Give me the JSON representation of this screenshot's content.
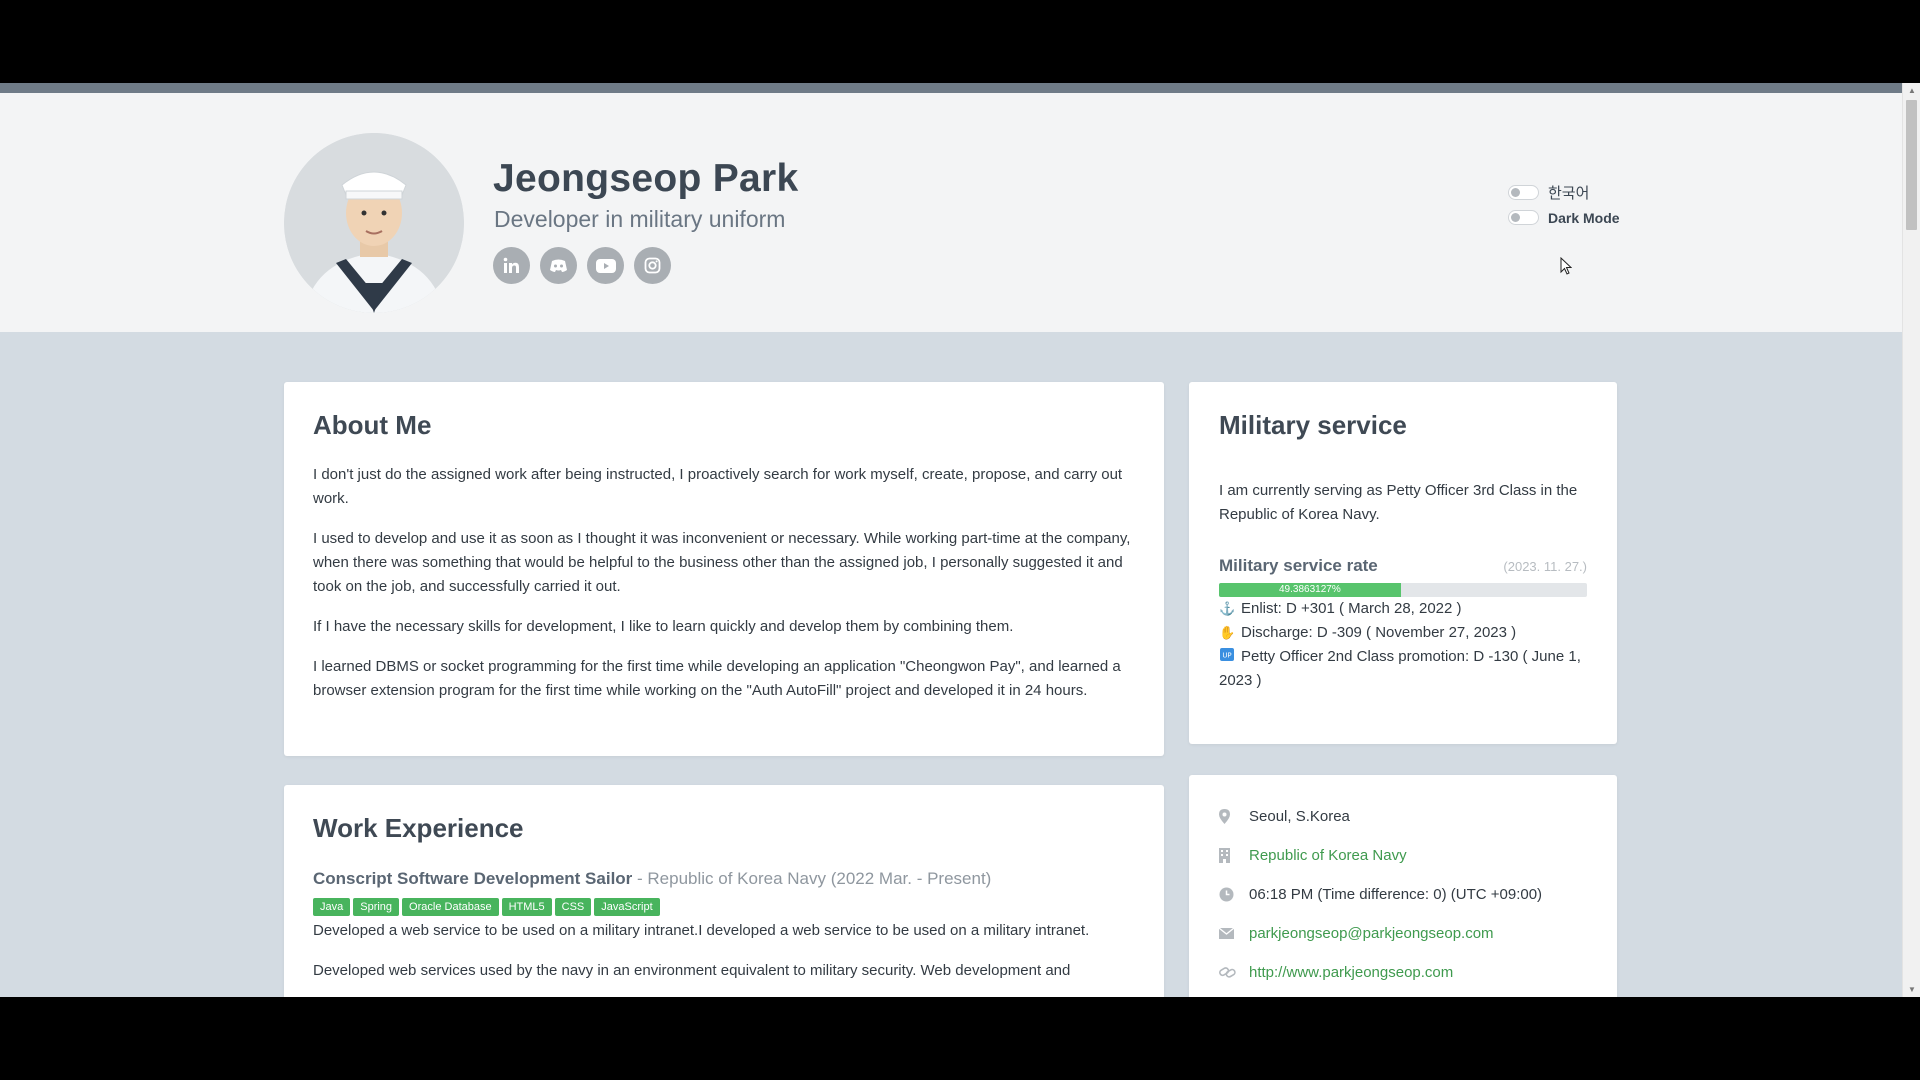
{
  "profile": {
    "name": "Jeongseop Park",
    "subtitle": "Developer in military uniform",
    "socials": [
      "linkedin-icon",
      "github-icon",
      "youtube-icon",
      "instagram-icon"
    ]
  },
  "toggles": {
    "language_label": "한국어",
    "dark_mode_label": "Dark Mode"
  },
  "about": {
    "title": "About Me",
    "paragraphs": [
      "I don't just do the assigned work after being instructed, I proactively search for work myself, create, propose, and carry out work.",
      "I used to develop and use it as soon as I thought it was inconvenient or necessary. While working part-time at the company, when there was something that would be helpful to the business other than the assigned job, I personally suggested it and took on the job, and successfully carried it out.",
      "If I have the necessary skills for development, I like to learn quickly and develop them by combining them.",
      "I learned DBMS or socket programming for the first time while developing an application \"Cheongwon Pay\", and learned a browser extension program for the first time while working on the \"Auth AutoFill\" project and developed it in 24 hours."
    ]
  },
  "military": {
    "title": "Military service",
    "description": "I am currently serving as Petty Officer 3rd Class in the Republic of Korea Navy.",
    "rate_title": "Military service rate",
    "rate_date": "(2023. 11. 27.)",
    "rate_label": "49.3863127%",
    "rate_percent": 49.3863127,
    "enlist": "Enlist: D +301 ( March 28, 2022 )",
    "discharge": "Discharge: D -309 ( November 27, 2023 )",
    "promotion": "Petty Officer 2nd Class promotion: D -130 ( June 1, 2023 )"
  },
  "work": {
    "title": "Work Experience",
    "job_title": "Conscript Software Development Sailor",
    "job_org": " - Republic of Korea Navy (2022 Mar. - Present)",
    "tags": [
      "Java",
      "Spring",
      "Oracle Database",
      "HTML5",
      "CSS",
      "JavaScript"
    ],
    "desc1": "Developed a web service to be used on a military intranet.I developed a web service to be used on a military intranet.",
    "desc2": "Developed web services used by the navy in an environment equivalent to military security. Web development and"
  },
  "info": {
    "location": "Seoul, S.Korea",
    "organization": "Republic of Korea Navy",
    "time": "06:18 PM (Time difference: 0) (UTC +09:00)",
    "email": "parkjeongseop@parkjeongseop.com",
    "website": "http://www.parkjeongseop.com"
  },
  "colors": {
    "accent": "#48b45d",
    "link": "#3f9a4e",
    "heading": "#3f4954"
  }
}
